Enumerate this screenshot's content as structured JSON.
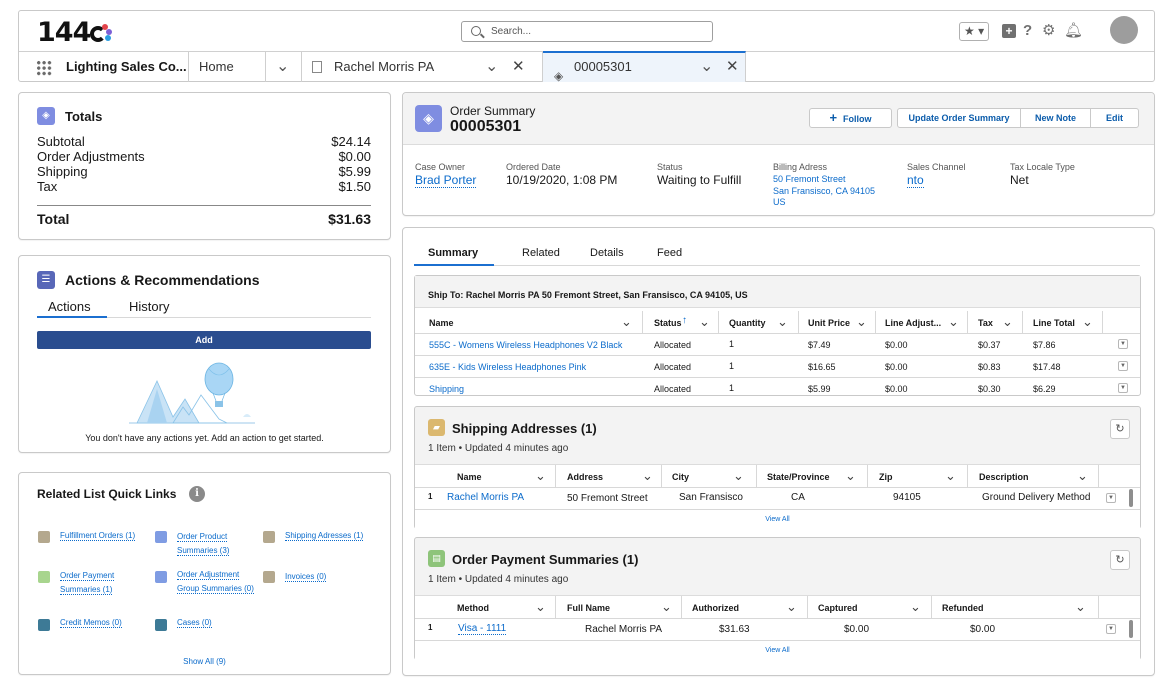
{
  "brand": "144",
  "search": {
    "placeholder": "Search..."
  },
  "tabs": {
    "app_name": "Lighting Sales Co...",
    "home": "Home",
    "record_tab": "Rachel Morris PA",
    "active_tab": "00005301"
  },
  "totals": {
    "title": "Totals",
    "rows": [
      {
        "label": "Subtotal",
        "value": "$24.14"
      },
      {
        "label": "Order Adjustments",
        "value": "$0.00"
      },
      {
        "label": "Shipping",
        "value": "$5.99"
      },
      {
        "label": "Tax",
        "value": "$1.50"
      }
    ],
    "total_label": "Total",
    "total_value": "$31.63"
  },
  "actions": {
    "title": "Actions & Recommendations",
    "tabs": [
      "Actions",
      "History"
    ],
    "add_label": "Add",
    "empty_text": "You don't have any actions yet. Add an action to get started."
  },
  "quick_links": {
    "title": "Related List Quick Links",
    "items": [
      {
        "label_1": "Fulfillment Orders (1)",
        "label_2": "",
        "color": "#b4a88e"
      },
      {
        "label_1": "Order Product",
        "label_2": "Summaries (3)",
        "color": "#7f9ce3"
      },
      {
        "label_1": "Shipping Adresses (1)",
        "label_2": "",
        "color": "#b4a88e"
      },
      {
        "label_1": "Order Payment",
        "label_2": "Summaries (1)",
        "color": "#a8d58e"
      },
      {
        "label_1": "Order Adjustment",
        "label_2": "Group Summaries (0)",
        "color": "#7f9ce3"
      },
      {
        "label_1": "Invoices (0)",
        "label_2": "",
        "color": "#b4a88e"
      },
      {
        "label_1": "Credit Memos (0)",
        "label_2": "",
        "color": "#3d7a96"
      },
      {
        "label_1": "Cases (0)",
        "label_2": "",
        "color": "#3d7a96"
      }
    ],
    "show_all": "Show All (9)"
  },
  "order": {
    "object_label": "Order Summary",
    "number": "00005301",
    "buttons": {
      "follow": "Follow",
      "update": "Update Order Summary",
      "new_note": "New Note",
      "edit": "Edit"
    },
    "fields": {
      "case_owner_label": "Case Owner",
      "case_owner": "Brad Porter",
      "ordered_date_label": "Ordered Date",
      "ordered_date": "10/19/2020, 1:08 PM",
      "status_label": "Status",
      "status": "Waiting to Fulfill",
      "billing_label": "Billing Adress",
      "billing_1": "50 Fremont Street",
      "billing_2": "San Fransisco, CA 94105",
      "billing_3": "US",
      "channel_label": "Sales Channel",
      "channel": "nto",
      "tax_label": "Tax Locale Type",
      "tax": "Net"
    }
  },
  "detail_tabs": [
    "Summary",
    "Related",
    "Details",
    "Feed"
  ],
  "products": {
    "ship_to": "Ship To: Rachel Morris PA 50 Fremont Street, San Fransisco, CA 94105, US",
    "headers": [
      "Name",
      "Status",
      "Quantity",
      "Unit Price",
      "Line Adjust...",
      "Tax",
      "Line Total"
    ],
    "rows": [
      [
        "555C - Womens Wireless Headphones V2 Black",
        "Allocated",
        "1",
        "$7.49",
        "$0.00",
        "$0.37",
        "$7.86"
      ],
      [
        "635E - Kids Wireless Headphones Pink",
        "Allocated",
        "1",
        "$16.65",
        "$0.00",
        "$0.83",
        "$17.48"
      ],
      [
        "Shipping",
        "Allocated",
        "1",
        "$5.99",
        "$0.00",
        "$0.30",
        "$6.29"
      ]
    ]
  },
  "shipping": {
    "title": "Shipping Addresses (1)",
    "subtitle": "1 Item • Updated 4 minutes ago",
    "headers": [
      "Name",
      "Address",
      "City",
      "State/Province",
      "Zip",
      "Description"
    ],
    "row": [
      "1",
      "Rachel Morris PA",
      "50 Fremont Street",
      "San Fransisco",
      "CA",
      "94105",
      "Ground Delivery Method"
    ],
    "view_all": "View All"
  },
  "payments": {
    "title": "Order Payment Summaries (1)",
    "subtitle": "1 Item • Updated 4 minutes ago",
    "headers": [
      "Method",
      "Full Name",
      "Authorized",
      "Captured",
      "Refunded"
    ],
    "row": [
      "1",
      "Visa - 1111",
      "Rachel Morris PA",
      "$31.63",
      "$0.00",
      "$0.00"
    ],
    "view_all": "View All"
  }
}
